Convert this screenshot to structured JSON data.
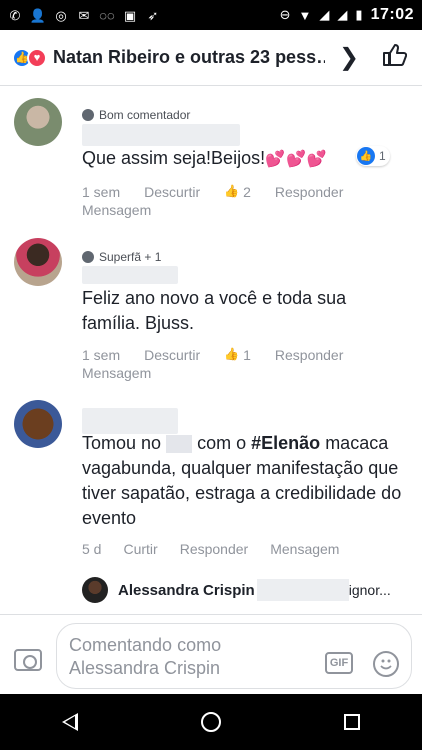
{
  "status": {
    "time": "17:02",
    "left_icons": [
      "whatsapp-icon",
      "person-add-icon",
      "instagram-icon",
      "message-icon",
      "voicemail-icon",
      "image-icon",
      "rocket-icon"
    ],
    "right_icons": [
      "do-not-disturb-icon",
      "wifi-icon",
      "signal-icon",
      "signal-icon",
      "battery-icon"
    ]
  },
  "header": {
    "title": "Natan Ribeiro e outras 23 pess…"
  },
  "comments": [
    {
      "badge": "Bom comentador",
      "text": "Que assim seja!Beijos!",
      "hearts": "💕💕💕",
      "reaction_count": "1",
      "time": "1 sem",
      "dislike": "Descurtir",
      "likes": "2",
      "reply": "Responder",
      "message": "Mensagem"
    },
    {
      "badge": "Superfã + 1",
      "text": "Feliz ano novo a você e toda sua família. Bjuss.",
      "time": "1 sem",
      "dislike": "Descurtir",
      "likes": "1",
      "reply": "Responder",
      "message": "Mensagem"
    },
    {
      "text_before": "Tomou no",
      "text_middle": "com o",
      "hashtag": "#Elenão",
      "text_after": "macaca vagabunda, qualquer manifestação que tiver sapatão, estraga a credibilidade do evento",
      "time": "5 d",
      "like": "Curtir",
      "reply": "Responder",
      "message": "Mensagem"
    }
  ],
  "reply_preview": {
    "name": "Alessandra Crispin",
    "text": "ignor..."
  },
  "composer": {
    "placeholder": "Comentando como Alessandra Crispin",
    "gif_label": "GIF"
  }
}
